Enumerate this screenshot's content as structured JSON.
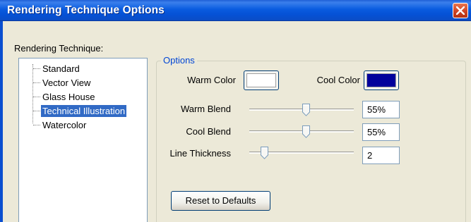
{
  "window": {
    "title": "Rendering Technique Options"
  },
  "technique": {
    "label": "Rendering Technique:",
    "items": [
      {
        "label": "Standard",
        "selected": false
      },
      {
        "label": "Vector View",
        "selected": false
      },
      {
        "label": "Glass House",
        "selected": false
      },
      {
        "label": "Technical Illustration",
        "selected": true
      },
      {
        "label": "Watercolor",
        "selected": false
      }
    ]
  },
  "options": {
    "legend": "Options",
    "warm_color": {
      "label": "Warm Color",
      "value": "#ffffff"
    },
    "cool_color": {
      "label": "Cool Color",
      "value": "#00009c"
    },
    "warm_blend": {
      "label": "Warm Blend",
      "value": "55%",
      "level": 0.55
    },
    "cool_blend": {
      "label": "Cool Blend",
      "value": "55%",
      "level": 0.55
    },
    "line_thickness": {
      "label": "Line Thickness",
      "value": "2",
      "level": 0.12
    },
    "reset_label": "Reset to Defaults"
  },
  "colors": {
    "titlebar": "#0552d6",
    "selection": "#316ac5",
    "legend_text": "#0046d5",
    "dialog_bg": "#ece9d8"
  },
  "icons": {
    "close": "close-x-icon",
    "slider_thumb": "slider-thumb-icon"
  }
}
